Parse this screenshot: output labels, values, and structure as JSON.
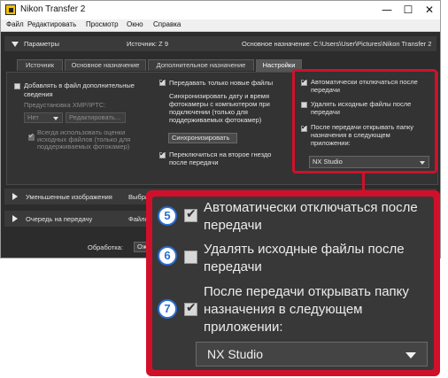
{
  "window": {
    "title": "Nikon Transfer 2",
    "controls": {
      "minimize": "—",
      "maximize": "☐",
      "close": "✕"
    }
  },
  "menu": [
    "Файл",
    "Редактировать",
    "Просмотр",
    "Окно",
    "Справка"
  ],
  "params_panel": {
    "title": "Параметры",
    "source": "Источник: Z 9",
    "destination": "Основное назначение: C:\\Users\\User\\Pictures\\Nikon Transfer 2"
  },
  "tabs": [
    "Источник",
    "Основное назначение",
    "Дополнительное назначение",
    "Настройки"
  ],
  "settings": {
    "add_info": "Добавлять в файл дополнительные сведения",
    "xmp_preset": "Предустановка XMP/IPTC:",
    "xmp_value": "Нет",
    "edit_button": "Редактировать...",
    "use_ratings": [
      "Всегда использовать оценки",
      "исходных файлов (только для",
      "поддерживаемых фотокамер)"
    ],
    "transfer_new": "Передавать только новые файлы",
    "sync_text": [
      "Синхронизировать дату и время",
      "фотокамеры с компьютером при",
      "подключении (только для",
      "поддерживаемых фотокамер)"
    ],
    "sync_button": "Синхронизировать",
    "switch_slot": [
      "Переключиться на второе гнездо",
      "после передачи"
    ],
    "auto_disconnect": [
      "Автоматически отключаться после",
      "передачи"
    ],
    "delete_source": [
      "Удалять исходные файлы после",
      "передачи"
    ],
    "open_after": [
      "После передачи открывать папку",
      "назначения в следующем",
      "приложении:"
    ],
    "app_value": "NX Studio"
  },
  "thumbnails_panel": {
    "title": "Уменьшенные изображения",
    "extra": "Выбра"
  },
  "queue_panel": {
    "title": "Очередь на передачу",
    "extra": "Файло"
  },
  "processing": {
    "label": "Обработка:",
    "value": "Ож"
  },
  "callout": {
    "badges": [
      "5",
      "6",
      "7"
    ],
    "auto_disconnect": [
      "Автоматически отключаться после",
      "передачи"
    ],
    "delete_source": [
      "Удалять исходные файлы после",
      "передачи"
    ],
    "open_after": [
      "После передачи открывать папку",
      "назначения в следующем",
      "приложении:"
    ],
    "app_value": "NX Studio"
  },
  "colors": {
    "highlight": "#d0102a",
    "badge": "#2b6fd6",
    "panel": "#2c2c2c"
  }
}
